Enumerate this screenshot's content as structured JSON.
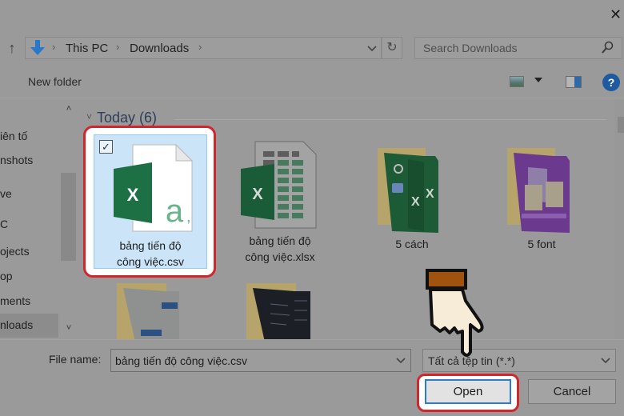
{
  "window": {
    "close_glyph": "✕"
  },
  "navigation": {
    "up_glyph": "↑",
    "breadcrumbs": [
      "This PC",
      "Downloads"
    ],
    "separator_glyph": "›",
    "dropdown_glyph": "⌄",
    "refresh_glyph": "↻"
  },
  "search": {
    "placeholder": "Search Downloads"
  },
  "toolbar": {
    "new_folder_label": "New folder",
    "help_glyph": "?"
  },
  "nav_pane": {
    "items": [
      {
        "label": "iên tố",
        "selected": false
      },
      {
        "label": "nshots",
        "selected": false
      },
      {
        "label": "ve",
        "selected": false
      },
      {
        "label": "C",
        "selected": false
      },
      {
        "label": "ojects",
        "selected": false
      },
      {
        "label": "op",
        "selected": false
      },
      {
        "label": "ments",
        "selected": false
      },
      {
        "label": "nloads",
        "selected": true
      }
    ],
    "scroll_up_glyph": "˄",
    "scroll_down_glyph": "˅"
  },
  "content": {
    "group_chevron": "˅",
    "group_header": "Today (6)",
    "files": [
      {
        "name_line1": "bảng tiến độ",
        "name_line2": "công việc.csv",
        "type": "csv",
        "selected": true,
        "checked": true
      },
      {
        "name_line1": "bảng tiến độ",
        "name_line2": "công việc.xlsx",
        "type": "xlsx",
        "selected": false
      },
      {
        "name_line1": "5 cách",
        "name_line2": "",
        "type": "folder-green",
        "selected": false
      },
      {
        "name_line1": "5 font",
        "name_line2": "",
        "type": "folder-purple",
        "selected": false
      },
      {
        "name_line1": "",
        "name_line2": "",
        "type": "folder-gray",
        "selected": false
      },
      {
        "name_line1": "",
        "name_line2": "",
        "type": "folder-dark",
        "selected": false
      }
    ],
    "checkbox_glyph": "✓"
  },
  "footer": {
    "filename_label": "File name:",
    "filename_value": "bảng tiến độ công việc.csv",
    "filetype_value": "Tất cả tệp tin (*.*)",
    "dropdown_glyph": "⌄",
    "open_label": "Open",
    "cancel_label": "Cancel"
  },
  "colors": {
    "highlight_border": "#d0262c",
    "selection_fill": "#cce4f7",
    "excel_green": "#1d7044",
    "open_button_border": "#2d7bc9"
  }
}
